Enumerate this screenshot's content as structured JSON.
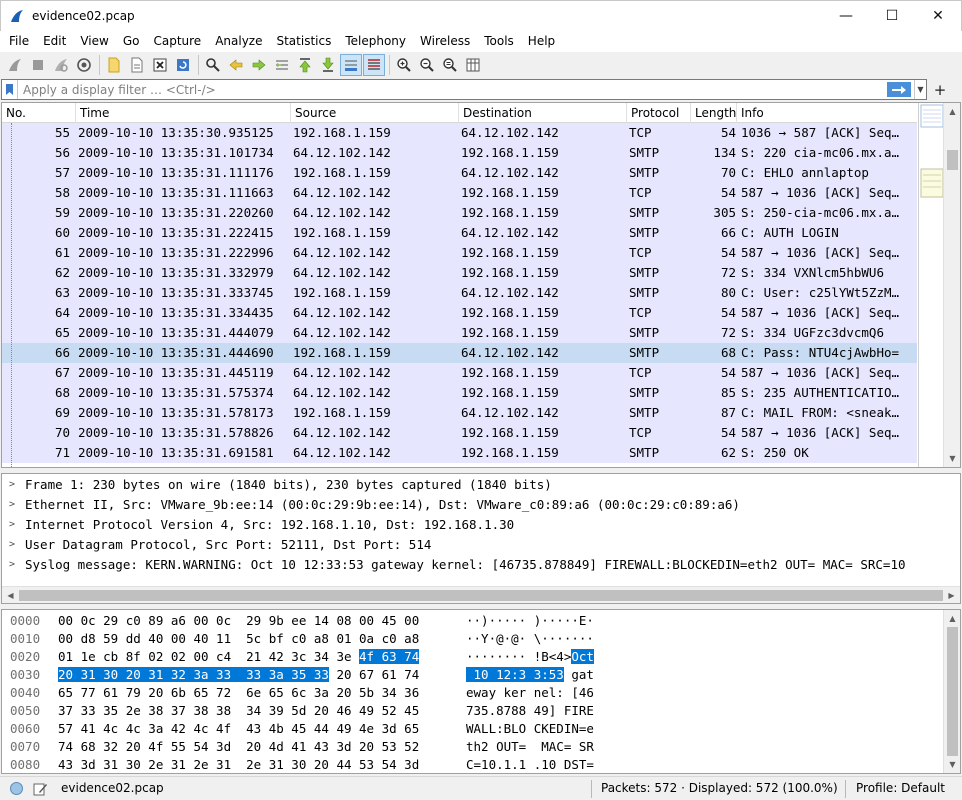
{
  "window": {
    "title": "evidence02.pcap",
    "minimize": "—",
    "maximize": "☐",
    "close": "✕"
  },
  "menu": [
    "File",
    "Edit",
    "View",
    "Go",
    "Capture",
    "Analyze",
    "Statistics",
    "Telephony",
    "Wireless",
    "Tools",
    "Help"
  ],
  "filter": {
    "placeholder": "Apply a display filter … <Ctrl-/>",
    "plus": "+"
  },
  "columns": [
    "No.",
    "Time",
    "Source",
    "Destination",
    "Protocol",
    "Length",
    "Info"
  ],
  "packets": [
    {
      "no": "55",
      "time": "2009-10-10 13:35:30.935125",
      "src": "192.168.1.159",
      "dst": "64.12.102.142",
      "proto": "TCP",
      "len": "54",
      "info": "1036 → 587 [ACK] Seq…"
    },
    {
      "no": "56",
      "time": "2009-10-10 13:35:31.101734",
      "src": "64.12.102.142",
      "dst": "192.168.1.159",
      "proto": "SMTP",
      "len": "134",
      "info": "S: 220 cia-mc06.mx.a…"
    },
    {
      "no": "57",
      "time": "2009-10-10 13:35:31.111176",
      "src": "192.168.1.159",
      "dst": "64.12.102.142",
      "proto": "SMTP",
      "len": "70",
      "info": "C: EHLO annlaptop"
    },
    {
      "no": "58",
      "time": "2009-10-10 13:35:31.111663",
      "src": "64.12.102.142",
      "dst": "192.168.1.159",
      "proto": "TCP",
      "len": "54",
      "info": "587 → 1036 [ACK] Seq…"
    },
    {
      "no": "59",
      "time": "2009-10-10 13:35:31.220260",
      "src": "64.12.102.142",
      "dst": "192.168.1.159",
      "proto": "SMTP",
      "len": "305",
      "info": "S: 250-cia-mc06.mx.a…"
    },
    {
      "no": "60",
      "time": "2009-10-10 13:35:31.222415",
      "src": "192.168.1.159",
      "dst": "64.12.102.142",
      "proto": "SMTP",
      "len": "66",
      "info": "C: AUTH LOGIN"
    },
    {
      "no": "61",
      "time": "2009-10-10 13:35:31.222996",
      "src": "64.12.102.142",
      "dst": "192.168.1.159",
      "proto": "TCP",
      "len": "54",
      "info": "587 → 1036 [ACK] Seq…"
    },
    {
      "no": "62",
      "time": "2009-10-10 13:35:31.332979",
      "src": "64.12.102.142",
      "dst": "192.168.1.159",
      "proto": "SMTP",
      "len": "72",
      "info": "S: 334 VXNlcm5hbWU6"
    },
    {
      "no": "63",
      "time": "2009-10-10 13:35:31.333745",
      "src": "192.168.1.159",
      "dst": "64.12.102.142",
      "proto": "SMTP",
      "len": "80",
      "info": "C: User: c25lYWt5ZzM…"
    },
    {
      "no": "64",
      "time": "2009-10-10 13:35:31.334435",
      "src": "64.12.102.142",
      "dst": "192.168.1.159",
      "proto": "TCP",
      "len": "54",
      "info": "587 → 1036 [ACK] Seq…"
    },
    {
      "no": "65",
      "time": "2009-10-10 13:35:31.444079",
      "src": "64.12.102.142",
      "dst": "192.168.1.159",
      "proto": "SMTP",
      "len": "72",
      "info": "S: 334 UGFzc3dvcmQ6"
    },
    {
      "no": "66",
      "time": "2009-10-10 13:35:31.444690",
      "src": "192.168.1.159",
      "dst": "64.12.102.142",
      "proto": "SMTP",
      "len": "68",
      "info": "C: Pass: NTU4cjAwbHo="
    },
    {
      "no": "67",
      "time": "2009-10-10 13:35:31.445119",
      "src": "64.12.102.142",
      "dst": "192.168.1.159",
      "proto": "TCP",
      "len": "54",
      "info": "587 → 1036 [ACK] Seq…"
    },
    {
      "no": "68",
      "time": "2009-10-10 13:35:31.575374",
      "src": "64.12.102.142",
      "dst": "192.168.1.159",
      "proto": "SMTP",
      "len": "85",
      "info": "S: 235 AUTHENTICATIO…"
    },
    {
      "no": "69",
      "time": "2009-10-10 13:35:31.578173",
      "src": "192.168.1.159",
      "dst": "64.12.102.142",
      "proto": "SMTP",
      "len": "87",
      "info": "C: MAIL FROM: <sneak…"
    },
    {
      "no": "70",
      "time": "2009-10-10 13:35:31.578826",
      "src": "64.12.102.142",
      "dst": "192.168.1.159",
      "proto": "TCP",
      "len": "54",
      "info": "587 → 1036 [ACK] Seq…"
    },
    {
      "no": "71",
      "time": "2009-10-10 13:35:31.691581",
      "src": "64.12.102.142",
      "dst": "192.168.1.159",
      "proto": "SMTP",
      "len": "62",
      "info": "S: 250 OK"
    }
  ],
  "selected_packet": "66",
  "details": [
    "Frame 1: 230 bytes on wire (1840 bits), 230 bytes captured (1840 bits)",
    "Ethernet II, Src: VMware_9b:ee:14 (00:0c:29:9b:ee:14), Dst: VMware_c0:89:a6 (00:0c:29:c0:89:a6)",
    "Internet Protocol Version 4, Src: 192.168.1.10, Dst: 192.168.1.30",
    "User Datagram Protocol, Src Port: 52111, Dst Port: 514",
    "Syslog message: KERN.WARNING: Oct 10 12:33:53 gateway kernel: [46735.878849] FIREWALL:BLOCKEDIN=eth2 OUT= MAC= SRC=10"
  ],
  "bytes": [
    {
      "offset": "0000",
      "hex": [
        "00 0c 29 c0 89 a6 00 0c  29 9b ee 14 08 00 45 00",
        "",
        ""
      ],
      "ascii": [
        "··)····· )·····E·",
        "",
        ""
      ]
    },
    {
      "offset": "0010",
      "hex": [
        "00 d8 59 dd 40 00 40 11  5c bf c0 a8 01 0a c0 a8",
        "",
        ""
      ],
      "ascii": [
        "··Y·@·@· \\·······",
        "",
        ""
      ]
    },
    {
      "offset": "0020",
      "hex": [
        "01 1e cb 8f 02 02 00 c4  21 42 3c 34 3e ",
        "4f 63 74",
        ""
      ],
      "ascii": [
        "········ !B<4>",
        "Oct",
        ""
      ]
    },
    {
      "offset": "0030",
      "hex": [
        "",
        "20 31 30 20 31 32 3a 33  33 3a 35 33",
        " 20 67 61 74"
      ],
      "ascii": [
        "",
        " 10 12:3 3:53",
        " gat"
      ]
    },
    {
      "offset": "0040",
      "hex": [
        "65 77 61 79 20 6b 65 72  6e 65 6c 3a 20 5b 34 36",
        "",
        ""
      ],
      "ascii": [
        "eway ker nel: [46",
        "",
        ""
      ]
    },
    {
      "offset": "0050",
      "hex": [
        "37 33 35 2e 38 37 38 38  34 39 5d 20 46 49 52 45",
        "",
        ""
      ],
      "ascii": [
        "735.8788 49] FIRE",
        "",
        ""
      ]
    },
    {
      "offset": "0060",
      "hex": [
        "57 41 4c 4c 3a 42 4c 4f  43 4b 45 44 49 4e 3d 65",
        "",
        ""
      ],
      "ascii": [
        "WALL:BLO CKEDIN=e",
        "",
        ""
      ]
    },
    {
      "offset": "0070",
      "hex": [
        "74 68 32 20 4f 55 54 3d  20 4d 41 43 3d 20 53 52",
        "",
        ""
      ],
      "ascii": [
        "th2 OUT=  MAC= SR",
        "",
        ""
      ]
    },
    {
      "offset": "0080",
      "hex": [
        "43 3d 31 30 2e 31 2e 31  2e 31 30 20 44 53 54 3d",
        "",
        ""
      ],
      "ascii": [
        "C=10.1.1 .10 DST=",
        "",
        ""
      ]
    }
  ],
  "status": {
    "file": "evidence02.pcap",
    "packets": "Packets: 572 · Displayed: 572 (100.0%)",
    "profile": "Profile: Default"
  },
  "colors": {
    "row_bg": "#e7e6ff",
    "row_selected": "#c7dbf2",
    "byte_highlight": "#0078d7"
  }
}
